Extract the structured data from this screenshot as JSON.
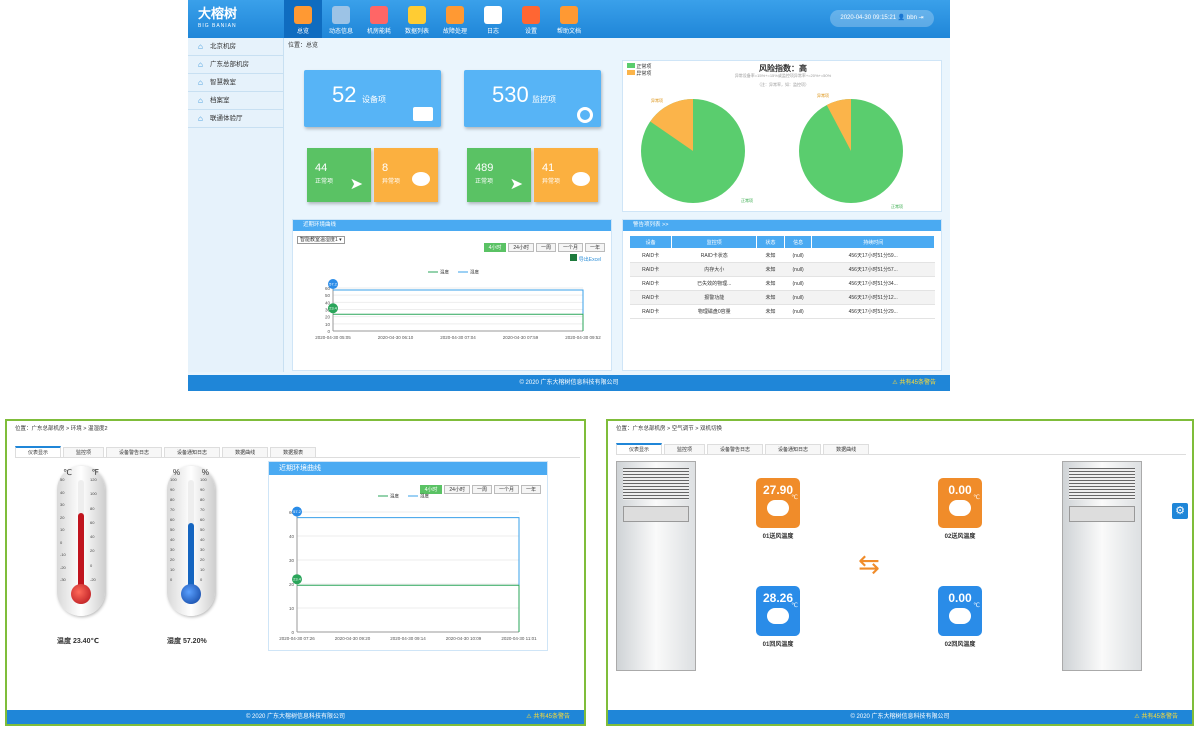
{
  "main": {
    "logo": {
      "name": "大榕树",
      "sub": "BIG BANIAN"
    },
    "nav": [
      {
        "label": "总览",
        "icon": "chart-icon"
      },
      {
        "label": "动态信息",
        "icon": "layers-icon"
      },
      {
        "label": "机房能耗",
        "icon": "line-chart-icon"
      },
      {
        "label": "数据列表",
        "icon": "document-icon"
      },
      {
        "label": "故障处理",
        "icon": "warning-icon"
      },
      {
        "label": "日志",
        "icon": "calendar-icon"
      },
      {
        "label": "设置",
        "icon": "settings-icon"
      },
      {
        "label": "帮助文档",
        "icon": "help-icon"
      }
    ],
    "user": {
      "datetime": "2020-04-30 09:15:21",
      "name": "bbn"
    },
    "sidebar": [
      "北京机房",
      "广东总部机房",
      "智慧教室",
      "档案室",
      "联通体验厅"
    ],
    "crumb": "位置：总览",
    "tiles": [
      {
        "value": "52",
        "label": "设备项"
      },
      {
        "value": "530",
        "label": "监控项"
      }
    ],
    "stats": [
      {
        "value": "44",
        "label": "正常项"
      },
      {
        "value": "8",
        "label": "异常项"
      },
      {
        "value": "489",
        "label": "正常项"
      },
      {
        "value": "41",
        "label": "异常项"
      }
    ],
    "risk": {
      "title": "风险指数：高",
      "legend": [
        "正常项",
        "异常项"
      ],
      "formula": "异常设备率=15%+=15%或监控项异常率+=20%+=50%",
      "formula2": "（注：异常率，如：监控项）",
      "pie_labels": [
        "异常项",
        "正常项",
        "异常项",
        "正常项"
      ]
    },
    "env": {
      "title": "近期环境曲线",
      "select": "智能教室温湿度1",
      "ranges": [
        "4小时",
        "24小时",
        "一周",
        "一个月",
        "一年"
      ],
      "export": "导出Excel",
      "legend": [
        "温度",
        "湿度"
      ],
      "yticks": [
        "60",
        "50",
        "40",
        "30",
        "20",
        "10",
        "0"
      ],
      "xticks": [
        "2020-04-30 05:05",
        "2020-04-30 06:10",
        "2020-04-30 07:04",
        "2020-04-30 07:59",
        "2020-04-30 09:52"
      ],
      "markers": [
        "57.2",
        "23.4"
      ]
    },
    "alerts": {
      "title": "警告项列表 >>",
      "headers": [
        "设备",
        "监控项",
        "状态",
        "信息",
        "持续时间"
      ],
      "rows": [
        [
          "RAID卡",
          "RAID卡状态",
          "未知",
          "(null)",
          "456天17小时51分59..."
        ],
        [
          "RAID卡",
          "内存大小",
          "未知",
          "(null)",
          "456天17小时51分57..."
        ],
        [
          "RAID卡",
          "已失效的物理...",
          "未知",
          "(null)",
          "456天17小时51分34..."
        ],
        [
          "RAID卡",
          "报警功能",
          "未知",
          "(null)",
          "456天17小时51分12..."
        ],
        [
          "RAID卡",
          "物理磁盘0容量",
          "未知",
          "(null)",
          "456天17小时51分29..."
        ]
      ]
    },
    "footer": "© 2020 广东大榕树信息科技有限公司",
    "warning": "共有45条警告"
  },
  "left": {
    "crumb": "位置：广东总部机房 > 环境 > 温湿度2",
    "tabs": [
      "仪表显示",
      "监控项",
      "设备警告日志",
      "设备通知日志",
      "数据曲线",
      "数据报表"
    ],
    "temp_units": [
      "℃",
      "℉"
    ],
    "hum_units": [
      "%",
      "%"
    ],
    "temp_ticks_c": [
      "50",
      "40",
      "30",
      "20",
      "10",
      "0",
      "-10",
      "-20",
      "-30"
    ],
    "temp_ticks_f": [
      "120",
      "100",
      "80",
      "60",
      "40",
      "20",
      "0",
      "-20"
    ],
    "hum_ticks": [
      "100",
      "90",
      "80",
      "70",
      "60",
      "50",
      "40",
      "30",
      "20",
      "10",
      "0"
    ],
    "temp_label": "温度  23.40℃",
    "hum_label": "湿度  57.20%",
    "chart": {
      "title": "近期环境曲线",
      "ranges": [
        "4小时",
        "24小时",
        "一周",
        "一个月",
        "一年"
      ],
      "legend": [
        "温度",
        "湿度"
      ],
      "yticks": [
        "60",
        "40",
        "30",
        "20",
        "10",
        "0"
      ],
      "xticks": [
        "2020-04-30 07:26",
        "2020-04-30 09:20",
        "2020-04-30 09:14",
        "2020-04-30 10:09",
        "2020-04-30 11:01"
      ],
      "markers": [
        "57.2",
        "23.4"
      ]
    },
    "footer": "© 2020 广东大榕树信息科技有限公司",
    "warning": "共有45条警告"
  },
  "right": {
    "crumb": "位置：广东总部机房 > 空气调节 > 双机切换",
    "tabs": [
      "仪表显示",
      "监控项",
      "设备警告日志",
      "设备通知日志",
      "数据曲线"
    ],
    "sensors": [
      {
        "value": "27.90",
        "unit": "℃",
        "label": "01送风温度",
        "color": "#f08c2a"
      },
      {
        "value": "0.00",
        "unit": "℃",
        "label": "02送风温度",
        "color": "#f08c2a"
      },
      {
        "value": "28.26",
        "unit": "℃",
        "label": "01回风温度",
        "color": "#2a8ce8"
      },
      {
        "value": "0.00",
        "unit": "℃",
        "label": "02回风温度",
        "color": "#2a8ce8"
      }
    ],
    "footer": "© 2020 广东大榕树信息科技有限公司",
    "warning": "共有45条警告"
  }
}
